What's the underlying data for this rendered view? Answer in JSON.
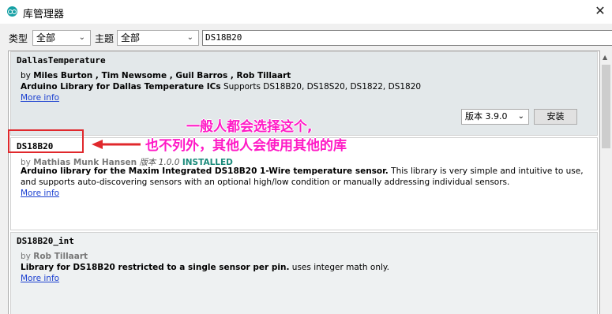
{
  "window": {
    "title": "库管理器",
    "close_glyph": "✕"
  },
  "filters": {
    "type_label": "类型",
    "type_value": "全部",
    "topic_label": "主题",
    "topic_value": "全部",
    "search_value": "DS18B20"
  },
  "libraries": [
    {
      "name": "DallasTemperature",
      "by_prefix": "by",
      "authors": "Miles Burton , Tim Newsome , Guil Barros , Rob Tillaart",
      "desc_bold": "Arduino Library for Dallas Temperature ICs",
      "desc_rest": "Supports DS18B20, DS18S20, DS1822, DS1820",
      "more_info": "More info",
      "version_select": "版本 3.9.0",
      "install_label": "安装"
    },
    {
      "name": "DS18B20",
      "by_prefix": "by",
      "authors": "Mathias Munk Hansen",
      "version_text": "版本 1.0.0",
      "status": "INSTALLED",
      "desc_bold": "Arduino library for the Maxim Integrated DS18B20 1-Wire temperature sensor.",
      "desc_rest": "This library is very simple and intuitive to use,",
      "desc_line2": "and supports auto-discovering sensors with an optional high/low condition or manually addressing individual sensors.",
      "more_info": "More info"
    },
    {
      "name": "DS18B20_int",
      "by_prefix": "by",
      "authors": "Rob Tillaart",
      "desc_bold": "Library for DS18B20 restricted to a single sensor per pin.",
      "desc_rest": "uses integer math only.",
      "more_info": "More info"
    }
  ],
  "annotation": {
    "line1": "一般人都会选择这个,",
    "line2": "也不列外，其他人会使用其他的库",
    "color": "#ff1ac6",
    "box_color": "#e0282c"
  }
}
